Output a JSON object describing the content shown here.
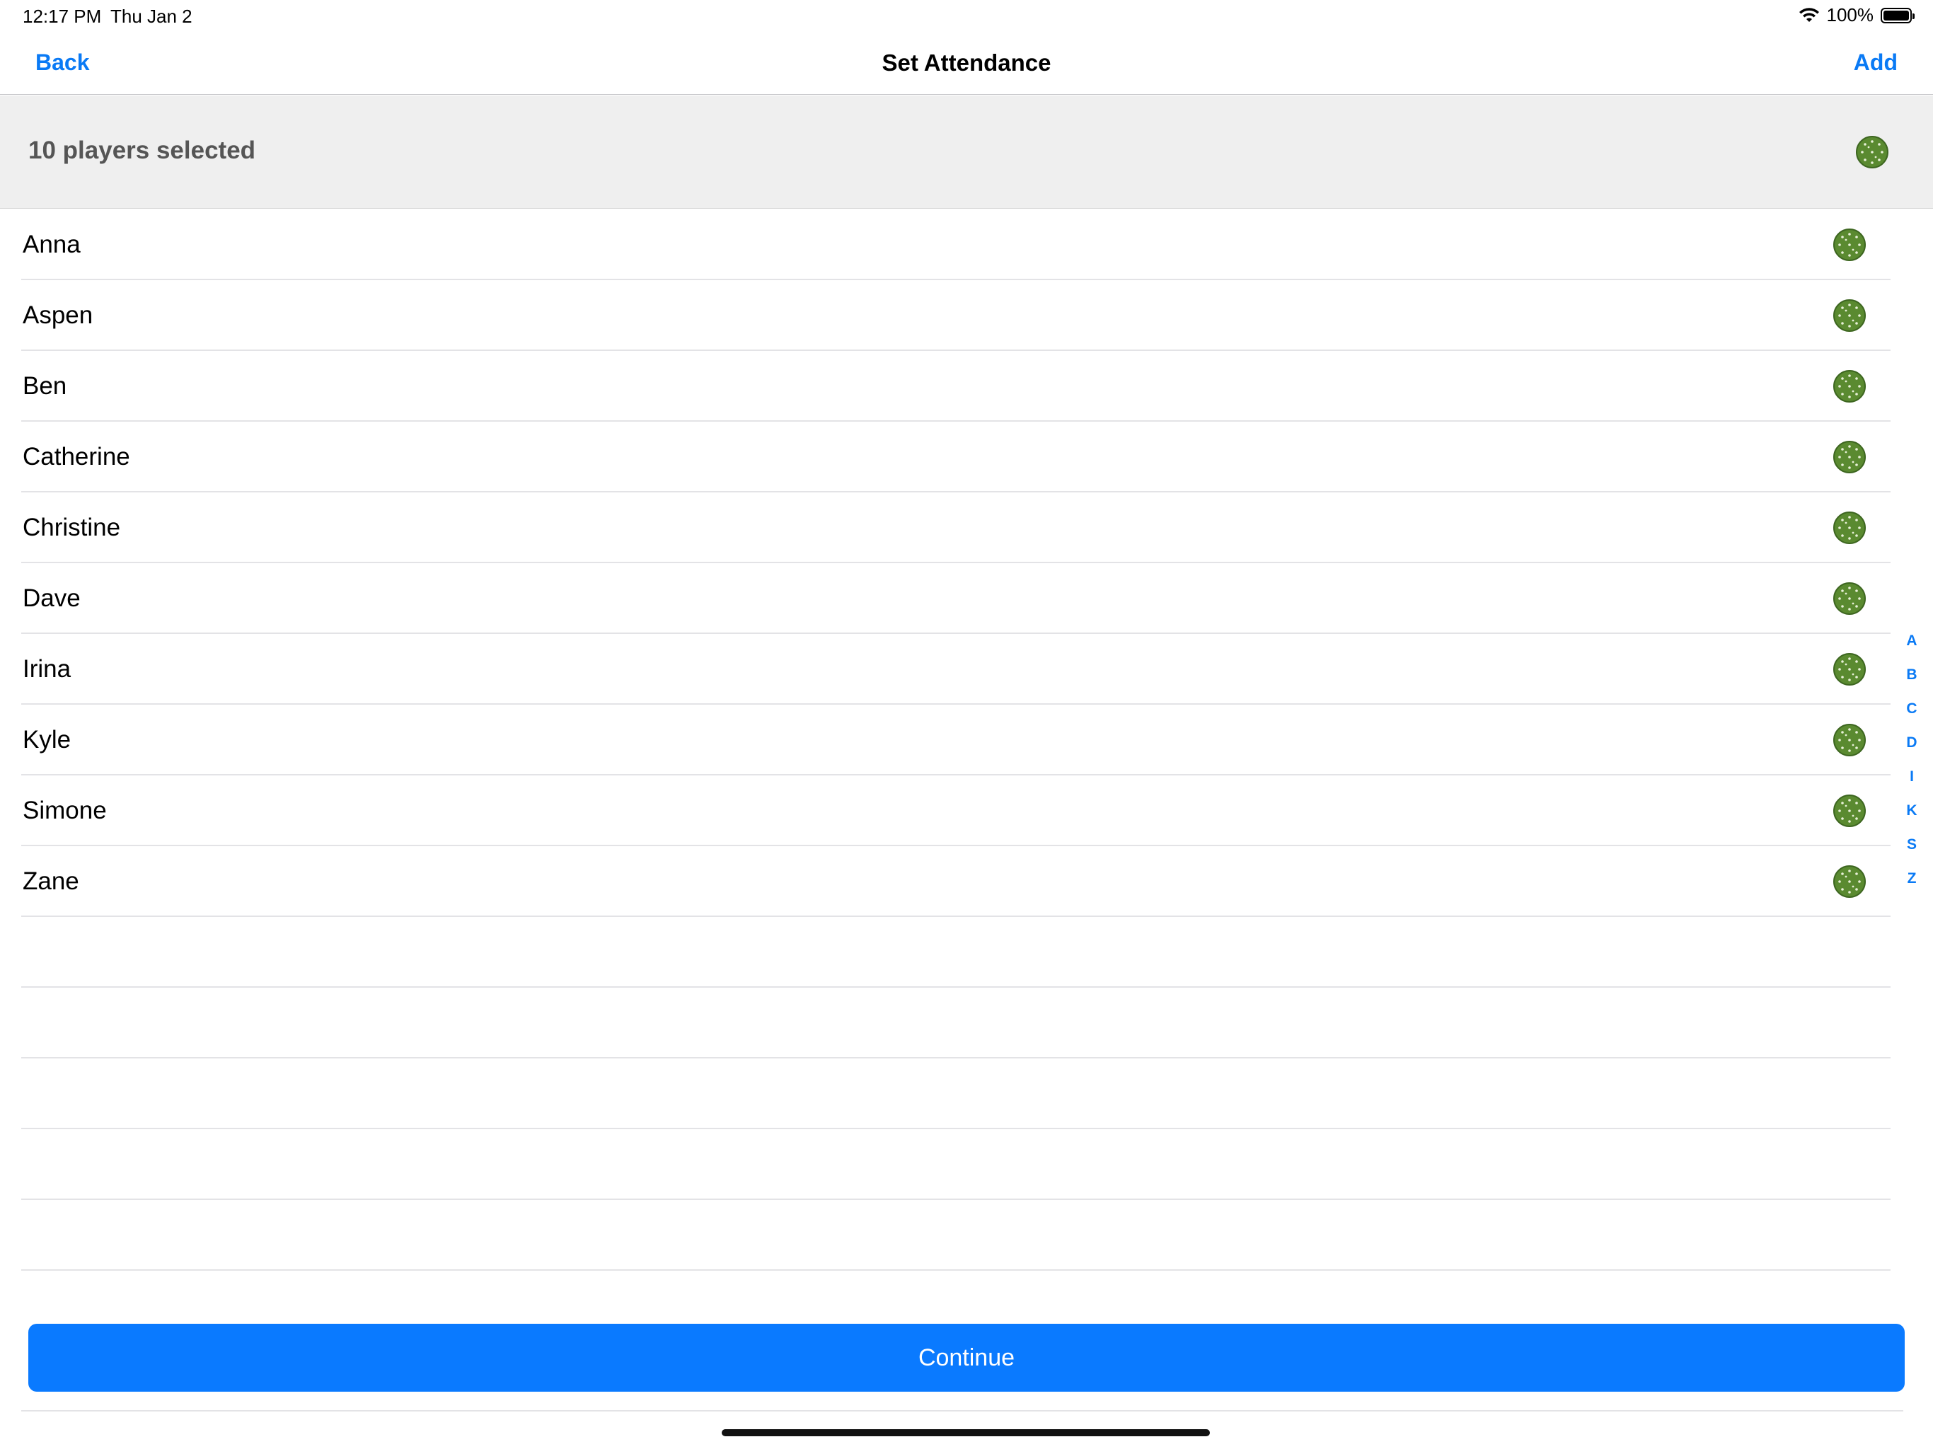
{
  "status_bar": {
    "time": "12:17 PM",
    "date": "Thu Jan 2",
    "battery": "100%"
  },
  "nav": {
    "back": "Back",
    "title": "Set Attendance",
    "add": "Add"
  },
  "selection": {
    "count_label": "10 players selected",
    "icon": "pickleball-icon"
  },
  "players": [
    {
      "name": "Anna",
      "selected": true
    },
    {
      "name": "Aspen",
      "selected": true
    },
    {
      "name": "Ben",
      "selected": true
    },
    {
      "name": "Catherine",
      "selected": true
    },
    {
      "name": "Christine",
      "selected": true
    },
    {
      "name": "Dave",
      "selected": true
    },
    {
      "name": "Irina",
      "selected": true
    },
    {
      "name": "Kyle",
      "selected": true
    },
    {
      "name": "Simone",
      "selected": true
    },
    {
      "name": "Zane",
      "selected": true
    }
  ],
  "index_letters": [
    "A",
    "B",
    "C",
    "D",
    "I",
    "K",
    "S",
    "Z"
  ],
  "continue_label": "Continue",
  "colors": {
    "accent": "#0a7aff",
    "ball": "#5a8a30"
  }
}
